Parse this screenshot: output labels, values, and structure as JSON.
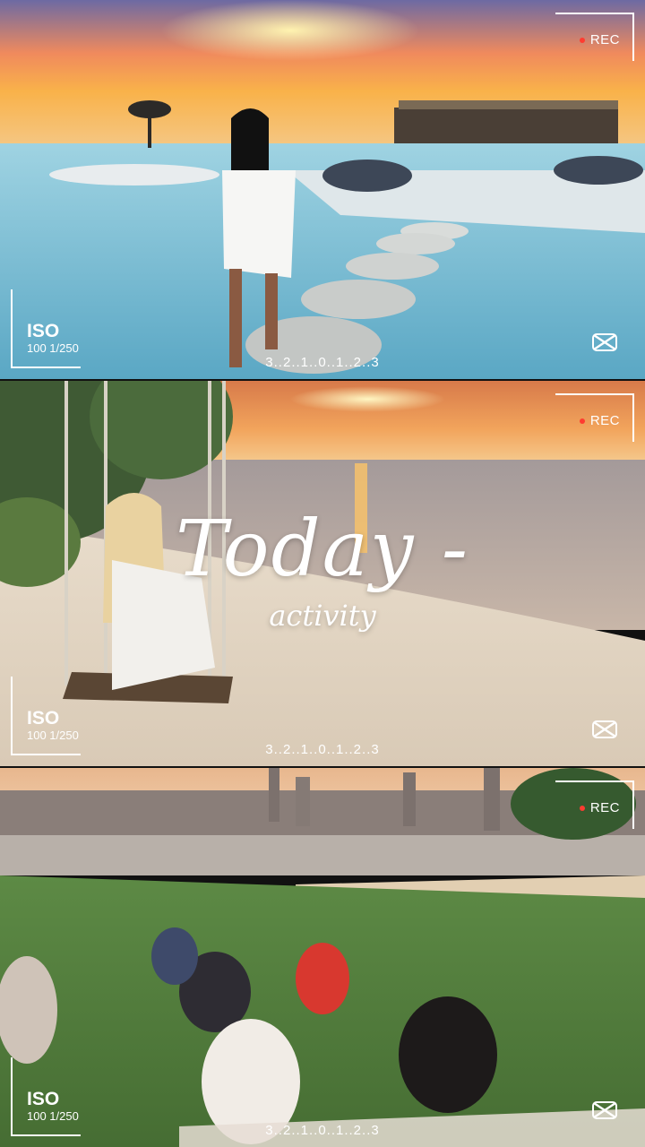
{
  "overlay": {
    "rec_label": "REC",
    "iso_label": "ISO",
    "iso_values": "100 1/250",
    "exposure_scale": "3..2..1..0..1..2..3"
  },
  "title": {
    "main": "Today -",
    "sub": "activity"
  },
  "colors": {
    "rec_dot": "#ff3b30",
    "overlay": "#ffffff"
  },
  "icons": [
    "capcut-logo-icon"
  ]
}
